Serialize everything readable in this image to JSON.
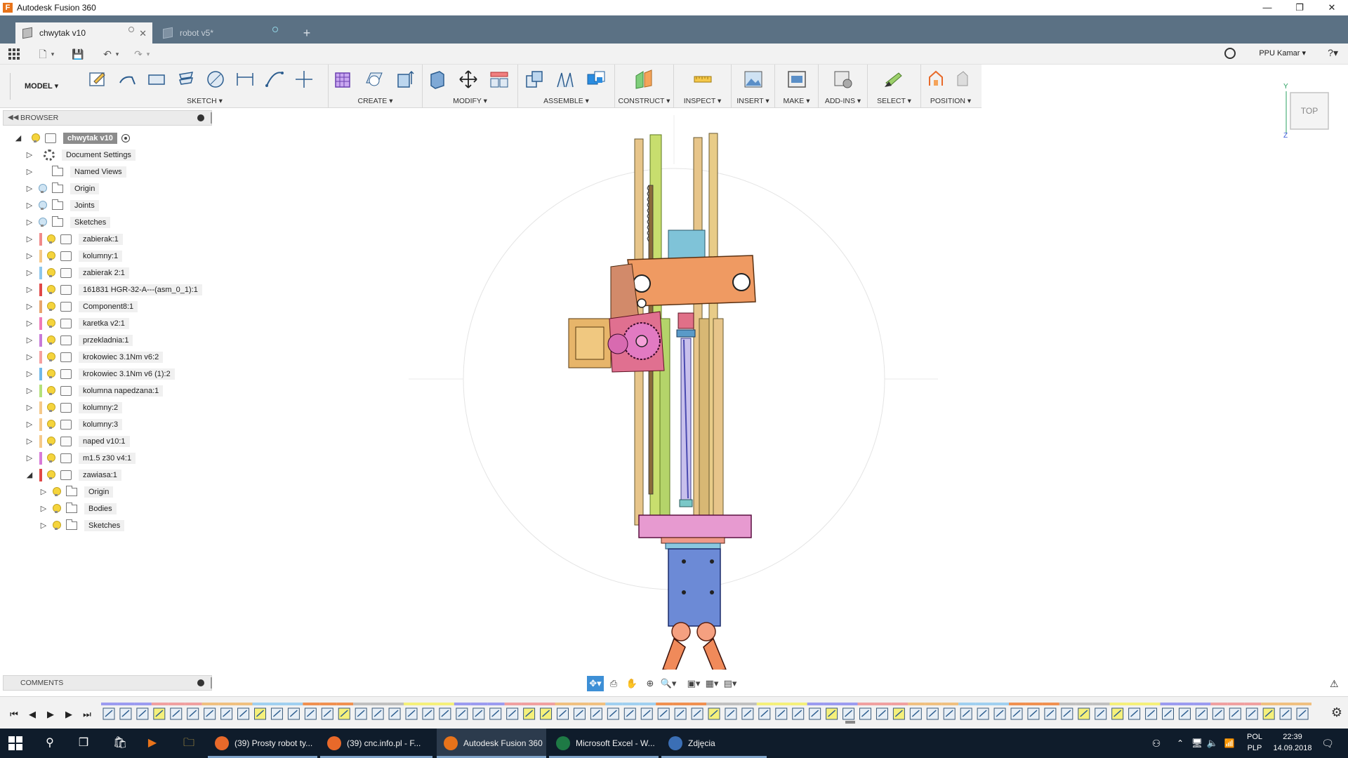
{
  "window": {
    "title": "Autodesk Fusion 360",
    "minimize": "—",
    "maximize": "❐",
    "close": "✕"
  },
  "tabs": [
    {
      "label": "chwytak v10",
      "active": true
    },
    {
      "label": "robot v5*",
      "active": false
    }
  ],
  "new_tab": "+",
  "quickbar": {
    "user": "PPU Kamar ▾",
    "help": "?▾"
  },
  "ribbon": {
    "workspace": "MODEL ▾",
    "groups": [
      {
        "label": "SKETCH ▾"
      },
      {
        "label": "CREATE ▾"
      },
      {
        "label": "MODIFY ▾"
      },
      {
        "label": "ASSEMBLE ▾"
      },
      {
        "label": "CONSTRUCT ▾"
      },
      {
        "label": "INSPECT ▾"
      },
      {
        "label": "INSERT ▾"
      },
      {
        "label": "MAKE ▾"
      },
      {
        "label": "ADD-INS ▾"
      },
      {
        "label": "SELECT ▾"
      },
      {
        "label": "POSITION ▾"
      }
    ]
  },
  "browser": {
    "title": "BROWSER",
    "root": "chwytak v10",
    "items": [
      {
        "label": "Document Settings",
        "type": "settings",
        "color": ""
      },
      {
        "label": "Named Views",
        "type": "folder",
        "color": ""
      },
      {
        "label": "Origin",
        "type": "folder",
        "color": ""
      },
      {
        "label": "Joints",
        "type": "folder",
        "color": ""
      },
      {
        "label": "Sketches",
        "type": "folder",
        "color": ""
      },
      {
        "label": "zabierak:1",
        "type": "component",
        "color": "#f08a8a"
      },
      {
        "label": "kolumny:1",
        "type": "component",
        "color": "#f5c98a"
      },
      {
        "label": "zabierak 2:1",
        "type": "component",
        "color": "#8ec7ec"
      },
      {
        "label": "161831 HGR-32-A---(asm_0_1):1",
        "type": "component",
        "color": "#e04848"
      },
      {
        "label": "Component8:1",
        "type": "component",
        "color": "#e8a46e"
      },
      {
        "label": "karetka v2:1",
        "type": "component",
        "color": "#ee7bb8"
      },
      {
        "label": "przekladnia:1",
        "type": "component",
        "color": "#c77ad8"
      },
      {
        "label": "krokowiec 3.1Nm v6:2",
        "type": "component",
        "color": "#f5a0a0"
      },
      {
        "label": "krokowiec 3.1Nm v6 (1):2",
        "type": "component",
        "color": "#6fb8e8"
      },
      {
        "label": "kolumna napedzana:1",
        "type": "component",
        "color": "#b4e07a"
      },
      {
        "label": "kolumny:2",
        "type": "component",
        "color": "#f5c98a"
      },
      {
        "label": "kolumny:3",
        "type": "component",
        "color": "#f5c98a"
      },
      {
        "label": "naped v10:1",
        "type": "component",
        "color": "#f5c98a"
      },
      {
        "label": "m1.5 z30 v4:1",
        "type": "component",
        "color": "#d87ad8"
      },
      {
        "label": "zawiasa:1",
        "type": "component",
        "color": "#e04848"
      }
    ],
    "subitems": [
      {
        "label": "Origin"
      },
      {
        "label": "Bodies"
      },
      {
        "label": "Sketches"
      }
    ]
  },
  "comments": {
    "title": "COMMENTS"
  },
  "viewcube": {
    "face": "TOP",
    "axis_y": "Y",
    "axis_z": "Z"
  },
  "navbar": [
    "✥▾",
    "⎙",
    "✋",
    "⊕",
    "🔍▾",
    "▣▾",
    "▦▾",
    "▤▾"
  ],
  "timeline": {
    "controls": [
      "⏮",
      "◀",
      "▶",
      "▶",
      "⏭"
    ],
    "marker_colors": [
      "#9b9bf0",
      "#f0a0a0",
      "#f0c080",
      "#a0d0f0",
      "#f09050",
      "#c0c0c0",
      "#f5f07a"
    ]
  },
  "taskbar": {
    "apps": [
      {
        "label": "(39) Prosty robot ty...",
        "icon_color": "#e8692a",
        "active": false
      },
      {
        "label": "(39) cnc.info.pl - F...",
        "icon_color": "#e8692a",
        "active": false
      },
      {
        "label": "Autodesk Fusion 360",
        "icon_color": "#e8731a",
        "active": true
      },
      {
        "label": "Microsoft Excel - W...",
        "icon_color": "#1e7a45",
        "active": false
      },
      {
        "label": "Zdjęcia",
        "icon_color": "#3b6fb5",
        "active": false
      }
    ],
    "lang_top": "POL",
    "lang_bottom": "PLP",
    "time": "22:39",
    "date": "14.09.2018"
  }
}
